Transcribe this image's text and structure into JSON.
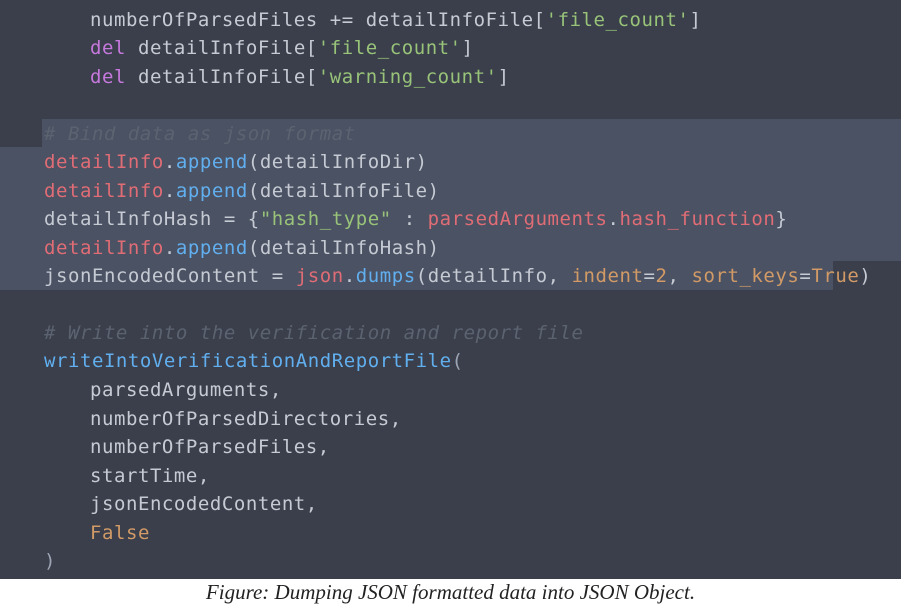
{
  "code": {
    "l1": {
      "t1": "numberOfParsedFiles += detailInfoFile[",
      "s": "'file_count'",
      "t2": "]"
    },
    "l2": {
      "kw": "del",
      "t1": " detailInfoFile[",
      "s": "'file_count'",
      "t2": "]"
    },
    "l3": {
      "kw": "del",
      "t1": " detailInfoFile[",
      "s": "'warning_count'",
      "t2": "]"
    },
    "l5": {
      "comment": "# Bind data as json format"
    },
    "l6": {
      "obj": "detailInfo",
      "dot": ".",
      "fn": "append",
      "args": "(detailInfoDir)"
    },
    "l7": {
      "obj": "detailInfo",
      "dot": ".",
      "fn": "append",
      "args": "(detailInfoFile)"
    },
    "l8": {
      "t1": "detailInfoHash = {",
      "s": "\"hash_type\"",
      "t2": " : ",
      "obj": "parsedArguments",
      "dot": ".",
      "attr": "hash_function",
      "t3": "}"
    },
    "l9": {
      "obj": "detailInfo",
      "dot": ".",
      "fn": "append",
      "args": "(detailInfoHash)"
    },
    "l10": {
      "t1": "jsonEncodedContent = ",
      "obj": "json",
      "dot": ".",
      "fn": "dumps",
      "t2": "(detailInfo, ",
      "k1": "indent",
      "eq1": "=",
      "n1": "2",
      "t3": ", ",
      "k2": "sort_keys",
      "eq2": "=",
      "n2": "True",
      "t4": ")"
    },
    "l12": {
      "comment": "# Write into the verification and report file"
    },
    "l13": {
      "fn": "writeIntoVerificationAndReportFile",
      "paren": "("
    },
    "args": [
      "parsedArguments,",
      "numberOfParsedDirectories,",
      "numberOfParsedFiles,",
      "startTime,",
      "jsonEncodedContent,"
    ],
    "l19": {
      "val": "False"
    },
    "l20": {
      "paren": ")"
    }
  },
  "caption": "Figure: Dumping JSON formatted data into JSON Object.",
  "colors": {
    "background": "#3a3f4b",
    "selection": "#4b5263",
    "keyword": "#c678dd",
    "string": "#98c379",
    "object": "#e06c75",
    "function": "#61afef",
    "number": "#d19a66",
    "comment": "#5c6370"
  }
}
